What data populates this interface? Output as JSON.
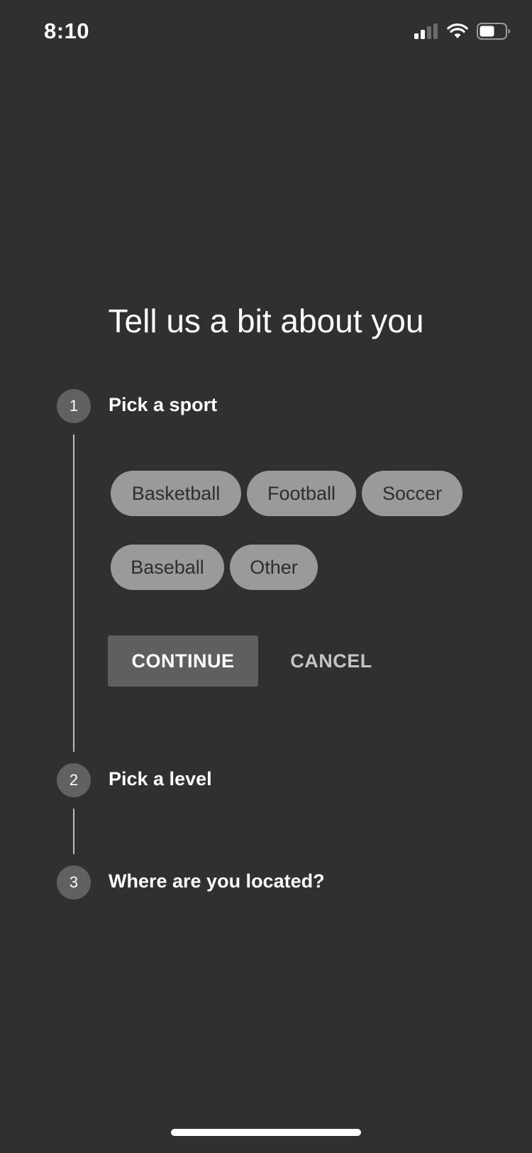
{
  "status_bar": {
    "time": "8:10",
    "icons": [
      "cellular-signal-icon",
      "wifi-icon",
      "battery-icon"
    ]
  },
  "title": "Tell us a bit about you",
  "steps": [
    {
      "number": "1",
      "label": "Pick a sport"
    },
    {
      "number": "2",
      "label": "Pick a level"
    },
    {
      "number": "3",
      "label": "Where are you located?"
    }
  ],
  "sports": [
    "Basketball",
    "Football",
    "Soccer",
    "Baseball",
    "Other"
  ],
  "actions": {
    "continue_label": "CONTINUE",
    "cancel_label": "CANCEL"
  },
  "colors": {
    "background": "#303030",
    "step_circle": "#616161",
    "chip": "#9a9a9a",
    "continue_button": "#5f5f5f"
  }
}
